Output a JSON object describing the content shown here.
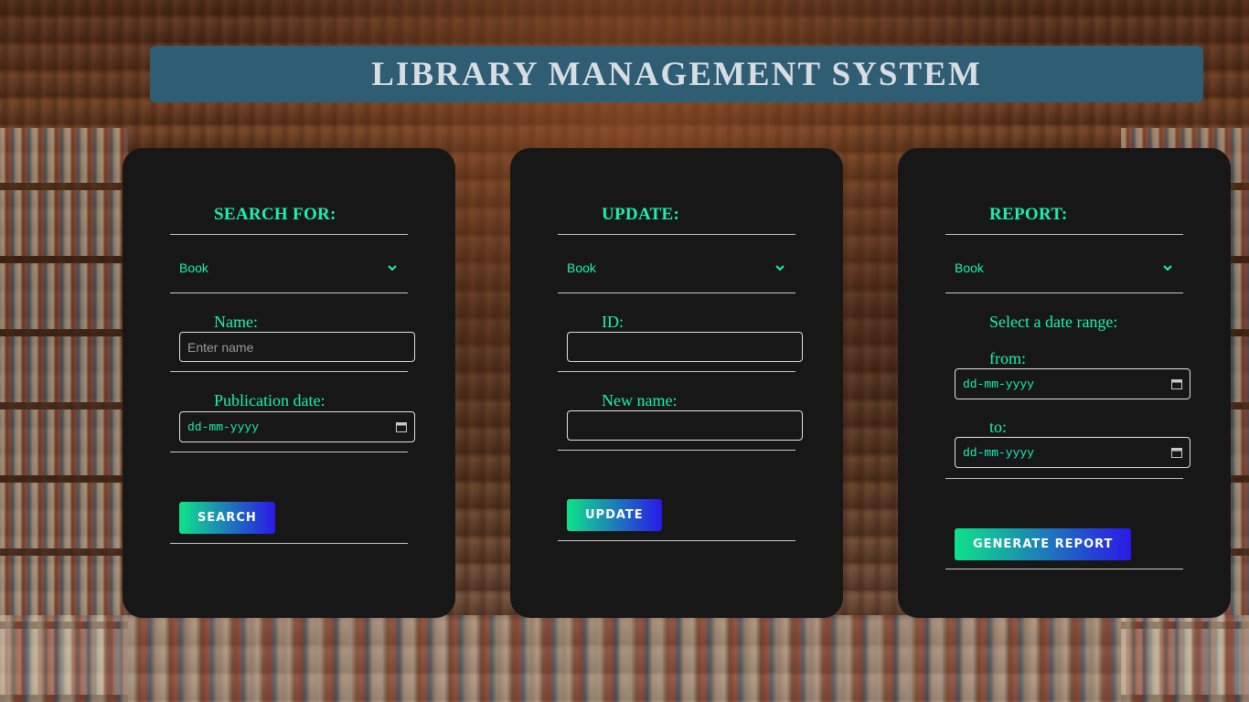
{
  "header": {
    "title": "LIBRARY MANAGEMENT SYSTEM"
  },
  "search": {
    "title": "SEARCH FOR:",
    "select_value": "Book",
    "name_label": "Name:",
    "name_placeholder": "Enter name",
    "date_label": "Publication date:",
    "date_value": "dd-mm-yyyy",
    "button_label": "SEARCH"
  },
  "update": {
    "title": "UPDATE:",
    "select_value": "Book",
    "id_label": "ID:",
    "id_value": "",
    "new_name_label": "New name:",
    "new_name_value": "",
    "button_label": "UPDATE"
  },
  "report": {
    "title": "REPORT:",
    "select_value": "Book",
    "range_label": "Select a date range:",
    "from_label": "from:",
    "from_value": "dd-mm-yyyy",
    "to_label": "to:",
    "to_value": "dd-mm-yyyy",
    "button_label": "GENERATE REPORT"
  },
  "colors": {
    "accent": "#19f2b0",
    "header_bg": "#2f5d74",
    "card_bg": "#171717",
    "button_gradient_start": "#0fe28a",
    "button_gradient_end": "#2a18e8"
  },
  "icons": {
    "select": "chevron-down-icon",
    "date": "calendar-icon"
  }
}
